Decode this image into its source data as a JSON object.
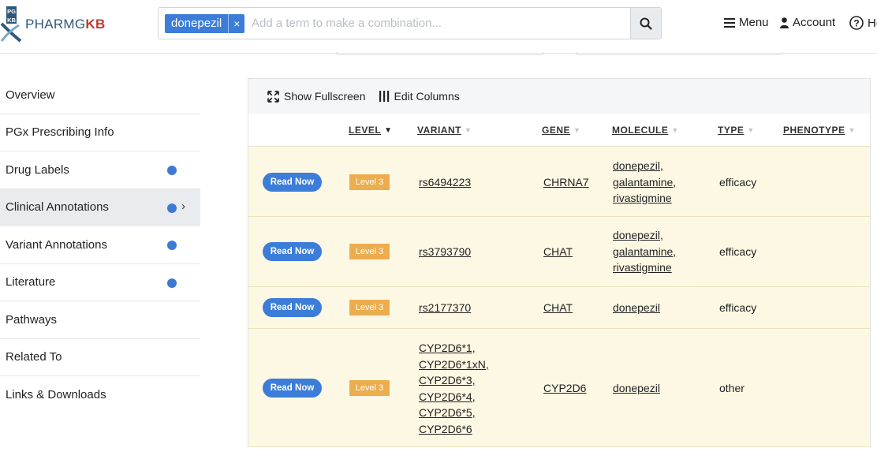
{
  "header": {
    "logo_badge_top": "PG",
    "logo_badge_bottom": "KB",
    "logo_pharm": "PHARMG",
    "logo_kb": "KB",
    "search": {
      "tag_label": "donepezil",
      "tag_remove": "×",
      "placeholder": "Add a term to make a combination..."
    },
    "nav": {
      "menu": "Menu",
      "account": "Account",
      "help": "He"
    }
  },
  "sidebar": {
    "items": [
      {
        "label": "Overview"
      },
      {
        "label": "PGx Prescribing Info"
      },
      {
        "label": "Drug Labels"
      },
      {
        "label": "Clinical Annotations"
      },
      {
        "label": "Variant Annotations"
      },
      {
        "label": "Literature"
      },
      {
        "label": "Pathways"
      },
      {
        "label": "Related To"
      },
      {
        "label": "Links & Downloads"
      }
    ]
  },
  "toolbar": {
    "fullscreen": "Show Fullscreen",
    "edit_columns": "Edit Columns"
  },
  "table": {
    "columns": {
      "level": "LEVEL",
      "variant": "VARIANT",
      "gene": "GENE",
      "molecule": "MOLECULE",
      "type": "TYPE",
      "phenotype": "PHENOTYPE"
    },
    "read_label": "Read Now",
    "level_label": "Level 3",
    "rows": [
      {
        "variant": [
          "rs6494223"
        ],
        "gene": "CHRNA7",
        "molecule": [
          "donepezil,",
          "galantamine,",
          "rivastigmine"
        ],
        "type": "efficacy"
      },
      {
        "variant": [
          "rs3793790"
        ],
        "gene": "CHAT",
        "molecule": [
          "donepezil,",
          "galantamine,",
          "rivastigmine"
        ],
        "type": "efficacy"
      },
      {
        "variant": [
          "rs2177370"
        ],
        "gene": "CHAT",
        "molecule": [
          "donepezil"
        ],
        "type": "efficacy"
      },
      {
        "variant": [
          "CYP2D6*1,",
          "CYP2D6*1xN,",
          "CYP2D6*3,",
          "CYP2D6*4,",
          "CYP2D6*5,",
          "CYP2D6*6"
        ],
        "gene": "CYP2D6",
        "molecule": [
          "donepezil"
        ],
        "type": "other"
      }
    ]
  }
}
